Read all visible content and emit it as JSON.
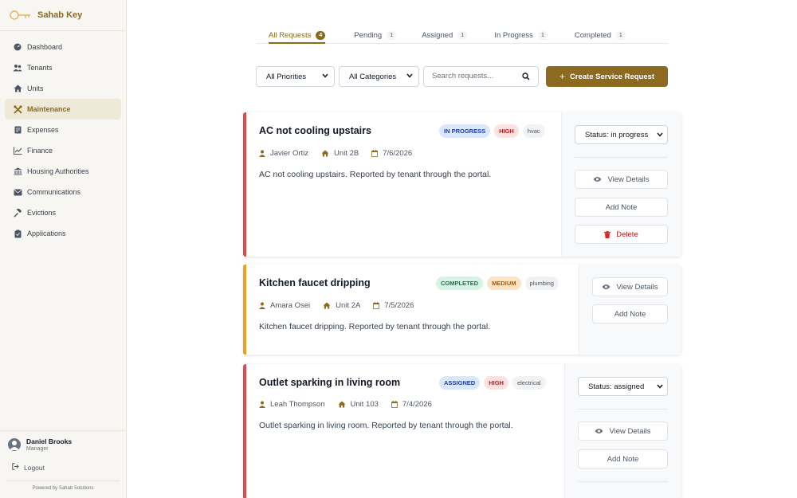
{
  "app": {
    "name": "Sahab Key",
    "accent": "#8c6a1f"
  },
  "sidebar": {
    "items": [
      {
        "label": "Dashboard",
        "icon": "gauge-icon"
      },
      {
        "label": "Tenants",
        "icon": "users-icon"
      },
      {
        "label": "Units",
        "icon": "home-icon"
      },
      {
        "label": "Maintenance",
        "icon": "tools-icon",
        "active": true
      },
      {
        "label": "Expenses",
        "icon": "receipt-icon"
      },
      {
        "label": "Finance",
        "icon": "chart-line-icon"
      },
      {
        "label": "Housing Authorities",
        "icon": "bank-icon"
      },
      {
        "label": "Communications",
        "icon": "envelope-icon"
      },
      {
        "label": "Evictions",
        "icon": "gavel-icon"
      },
      {
        "label": "Applications",
        "icon": "clipboard-icon"
      }
    ],
    "user": {
      "name": "Daniel Brooks",
      "role": "Manager"
    },
    "logout_label": "Logout",
    "powered_by": "Powered by Sahab Solutions"
  },
  "tabs": [
    {
      "label": "All Requests",
      "count": "4",
      "active": true
    },
    {
      "label": "Pending",
      "count": "1"
    },
    {
      "label": "Assigned",
      "count": "1"
    },
    {
      "label": "In Progress",
      "count": "1"
    },
    {
      "label": "Completed",
      "count": "1"
    }
  ],
  "filters": {
    "priority": "All Priorities",
    "category": "All Categories",
    "search_placeholder": "Search requests...",
    "create_label": "Create Service Request"
  },
  "requests": [
    {
      "title": "AC not cooling upstairs",
      "status": "IN PROGRESS",
      "priority": "HIGH",
      "category": "hvac",
      "tenant": "Javier Ortiz",
      "unit": "Unit 2B",
      "date": "7/6/2026",
      "description": "AC not cooling upstairs. Reported by tenant through the portal.",
      "status_select": "Status: in progress",
      "bar_color": "#dc4c4c"
    },
    {
      "title": "Kitchen faucet dripping",
      "status": "COMPLETED",
      "priority": "MEDIUM",
      "category": "plumbing",
      "tenant": "Amara Osei",
      "unit": "Unit 2A",
      "date": "7/5/2026",
      "description": "Kitchen faucet dripping. Reported by tenant through the portal.",
      "bar_color": "#e9a21c"
    },
    {
      "title": "Outlet sparking in living room",
      "status": "ASSIGNED",
      "priority": "HIGH",
      "category": "electrical",
      "tenant": "Leah Thompson",
      "unit": "Unit 103",
      "date": "7/4/2026",
      "description": "Outlet sparking in living room. Reported by tenant through the portal.",
      "status_select": "Status: assigned",
      "bar_color": "#dc4c4c"
    }
  ],
  "actions": {
    "view_details": "View Details",
    "add_note": "Add Note",
    "delete": "Delete"
  }
}
